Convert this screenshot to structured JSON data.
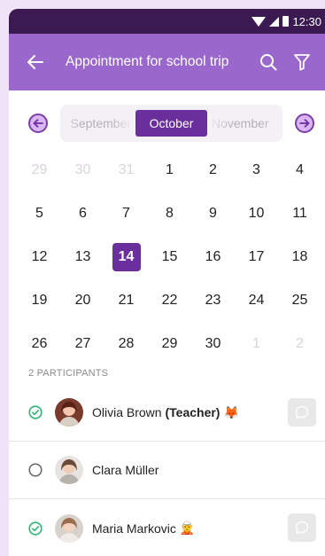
{
  "status_bar": {
    "time": "12:30"
  },
  "app_bar": {
    "title": "Appointment for school trip"
  },
  "month_nav": {
    "previous": "September",
    "current": "October",
    "next": "November"
  },
  "calendar": {
    "weeks": [
      [
        {
          "d": "29",
          "m": true
        },
        {
          "d": "30",
          "m": true
        },
        {
          "d": "31",
          "m": true
        },
        {
          "d": "1"
        },
        {
          "d": "2"
        },
        {
          "d": "3"
        },
        {
          "d": "4"
        }
      ],
      [
        {
          "d": "5"
        },
        {
          "d": "6"
        },
        {
          "d": "7"
        },
        {
          "d": "8"
        },
        {
          "d": "9"
        },
        {
          "d": "10"
        },
        {
          "d": "11"
        }
      ],
      [
        {
          "d": "12"
        },
        {
          "d": "13"
        },
        {
          "d": "14",
          "s": true
        },
        {
          "d": "15"
        },
        {
          "d": "16"
        },
        {
          "d": "17"
        },
        {
          "d": "18"
        }
      ],
      [
        {
          "d": "19"
        },
        {
          "d": "20"
        },
        {
          "d": "21"
        },
        {
          "d": "22"
        },
        {
          "d": "23"
        },
        {
          "d": "24"
        },
        {
          "d": "25"
        }
      ],
      [
        {
          "d": "26"
        },
        {
          "d": "27"
        },
        {
          "d": "28"
        },
        {
          "d": "29"
        },
        {
          "d": "30"
        },
        {
          "d": "1",
          "m": true
        },
        {
          "d": "2",
          "m": true
        }
      ]
    ]
  },
  "participants": {
    "label": "2 PARTICIPANTS",
    "items": [
      {
        "name": "Olivia Brown",
        "role": "(Teacher)",
        "emoji": "🦊",
        "confirmed": true,
        "chat": true
      },
      {
        "name": "Clara Müller",
        "role": "",
        "emoji": "",
        "confirmed": false,
        "chat": false
      },
      {
        "name": "Maria Markovic",
        "role": "",
        "emoji": "🧝",
        "confirmed": true,
        "chat": true
      }
    ]
  },
  "colors": {
    "primary": "#9a67cd",
    "accent": "#6a2f9c",
    "check": "#2bb673"
  }
}
